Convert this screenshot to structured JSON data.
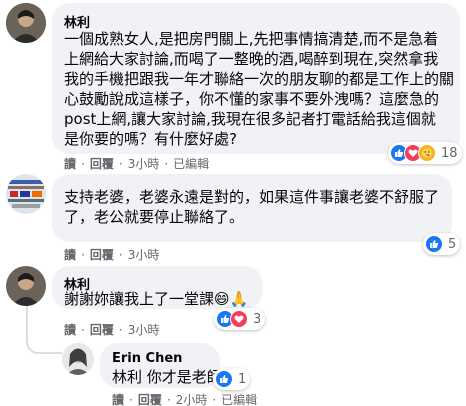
{
  "comments": [
    {
      "author": "林利",
      "lines": [
        "一個成熟女人,是把房門關上,先把事情搞清楚,而不是急着",
        "上網給大家討論,而喝了一整晚的酒,喝醉到現在,突然拿我",
        "我的手機把跟我一年才聯絡一次的朋友聊的都是工作上的關",
        "心鼓勵說成這樣子，你不懂的家事不要外洩嗎？這麼急的",
        "post上網,讓大家討論,我現在很多記者打電話給我這個就",
        "是你要的嗎？有什麼好處?"
      ],
      "actions": {
        "read": "讀",
        "reply": "回覆",
        "time": "3小時",
        "edited": "已編輯"
      },
      "reaction_count": "18",
      "reaction_icons": [
        "like-icon",
        "love-icon",
        "care-icon"
      ]
    },
    {
      "author": "",
      "lines": [
        "支持老婆，老婆永遠是對的，如果這件事讓老婆不舒服了",
        "了，老公就要停止聯絡了。"
      ],
      "actions": {
        "read": "讀",
        "reply": "回覆",
        "time": "3小時"
      },
      "reaction_count": "5",
      "reaction_icons": [
        "like-icon"
      ]
    },
    {
      "author": "林利",
      "lines": [
        "謝謝妳讓我上了一堂課😄🙏"
      ],
      "actions": {
        "read": "讀",
        "reply": "回覆",
        "time": "3小時"
      },
      "reaction_count": "3",
      "reaction_icons": [
        "like-icon",
        "love-icon"
      ]
    },
    {
      "author": "Erin Chen",
      "lines": [
        "林利 你才是老師"
      ],
      "actions": {
        "read": "讀",
        "reply": "回覆",
        "time": "2小時",
        "edited": "已編輯"
      },
      "reaction_count": "1",
      "reaction_icons": [
        "like-icon"
      ]
    }
  ],
  "colors": {
    "like": "#1877f2",
    "love": "#f33e58",
    "care": "#f7b125",
    "bubble": "#f0f2f5",
    "meta": "#65676b"
  }
}
